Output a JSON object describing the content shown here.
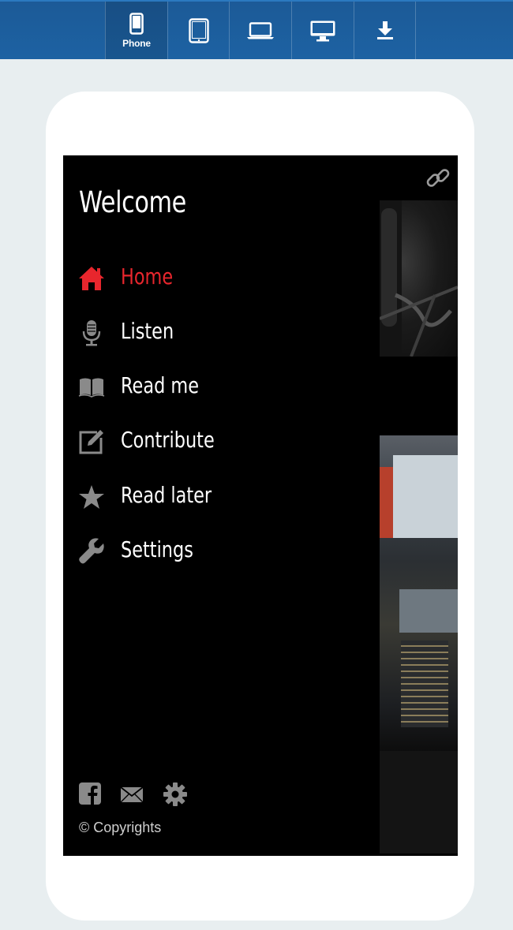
{
  "toolbar": {
    "buttons": [
      {
        "id": "phone",
        "label": "Phone",
        "icon": "phone-icon",
        "active": true
      },
      {
        "id": "tablet",
        "label": "",
        "icon": "tablet-icon"
      },
      {
        "id": "laptop",
        "label": "",
        "icon": "laptop-icon"
      },
      {
        "id": "desktop",
        "label": "",
        "icon": "desktop-icon"
      },
      {
        "id": "download",
        "label": "",
        "icon": "download-icon"
      }
    ]
  },
  "drawer": {
    "title": "Welcome",
    "menu": [
      {
        "label": "Home",
        "icon": "home-icon",
        "active": true
      },
      {
        "label": "Listen",
        "icon": "microphone-icon"
      },
      {
        "label": "Read me",
        "icon": "book-icon"
      },
      {
        "label": "Contribute",
        "icon": "edit-icon"
      },
      {
        "label": "Read later",
        "icon": "star-icon"
      },
      {
        "label": "Settings",
        "icon": "wrench-icon"
      }
    ],
    "footer_icons": [
      "facebook-icon",
      "mail-icon",
      "gear-icon"
    ],
    "copyright": "© Copyrights"
  },
  "colors": {
    "toolbar": "#1d5f9f",
    "active_menu": "#e8262d",
    "icon_gray": "#8a8a8a",
    "drawer_bg": "#000000"
  }
}
